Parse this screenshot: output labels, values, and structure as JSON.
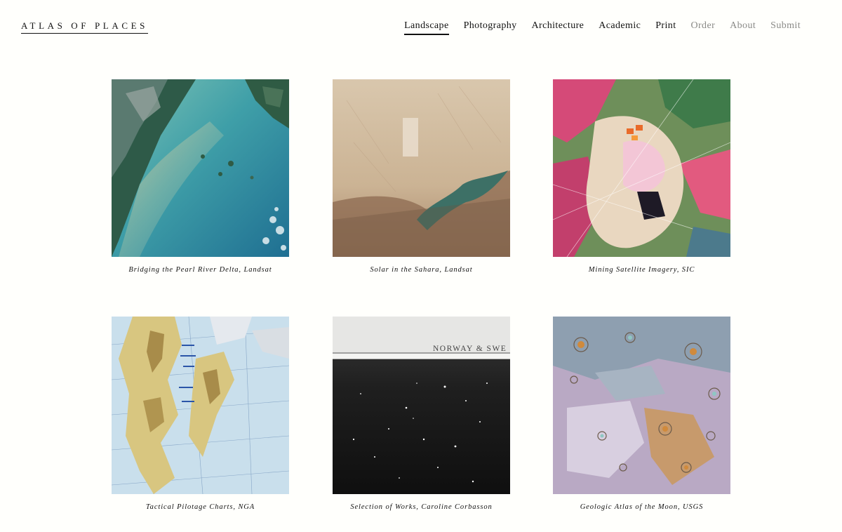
{
  "site": {
    "logo": "ATLAS OF PLACES"
  },
  "nav": {
    "items": [
      {
        "label": "Landscape"
      },
      {
        "label": "Photography"
      },
      {
        "label": "Architecture"
      },
      {
        "label": "Academic"
      },
      {
        "label": "Print"
      },
      {
        "label": "Order"
      },
      {
        "label": "About"
      },
      {
        "label": "Submit"
      }
    ],
    "active": "Landscape"
  },
  "gallery": {
    "items": [
      {
        "caption": "Bridging the Pearl River Delta, Landsat",
        "image": "satellite-river-delta"
      },
      {
        "caption": "Solar in the Sahara, Landsat",
        "image": "satellite-desert-lake"
      },
      {
        "caption": "Mining Satellite Imagery, SIC",
        "image": "false-color-mining"
      },
      {
        "caption": "Tactical Pilotage Charts, NGA",
        "image": "arctic-pilot-chart"
      },
      {
        "caption": "Selection of Works, Caroline Corbasson",
        "image": "star-chart-photo",
        "map_header": "NORWAY & SWE"
      },
      {
        "caption": "Geologic Atlas of the Moon, USGS",
        "image": "lunar-geologic-map"
      }
    ]
  },
  "colors": {
    "background": "#fffffc",
    "text": "#111111",
    "muted": "#8a8a87"
  }
}
